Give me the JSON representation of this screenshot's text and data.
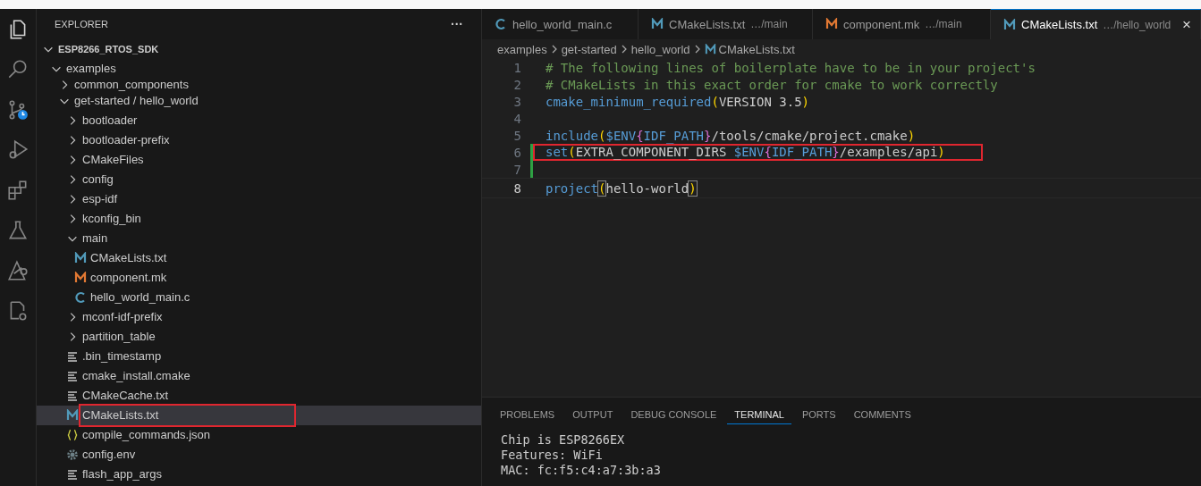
{
  "activity_bar": [
    {
      "kind": "files",
      "selected": true
    },
    {
      "kind": "search",
      "selected": false
    },
    {
      "kind": "source_control",
      "selected": false
    },
    {
      "kind": "run_debug",
      "selected": false
    },
    {
      "kind": "extensions",
      "selected": false
    },
    {
      "kind": "testing",
      "selected": false
    },
    {
      "kind": "idf",
      "selected": false
    },
    {
      "kind": "cpp_config",
      "selected": false
    }
  ],
  "sidebar": {
    "title": "EXPLORER",
    "more": "···",
    "tree": [
      {
        "label": "ESP8266_RTOS_SDK",
        "kind": "folder",
        "expanded": true,
        "selected": false,
        "children": [
          {
            "label": "examples",
            "kind": "folder",
            "expanded": true,
            "selected": false,
            "children": [
              {
                "label": "common_components",
                "kind": "folder",
                "expanded": false,
                "selected": false,
                "sticky_under": true
              },
              {
                "label": "get-started / hello_world",
                "kind": "folder",
                "expanded": true,
                "selected": false,
                "children": [
                  {
                    "label": "bootloader",
                    "kind": "folder",
                    "expanded": false,
                    "selected": false
                  },
                  {
                    "label": "bootloader-prefix",
                    "kind": "folder",
                    "expanded": false,
                    "selected": false
                  },
                  {
                    "label": "CMakeFiles",
                    "kind": "folder",
                    "expanded": false,
                    "selected": false
                  },
                  {
                    "label": "config",
                    "kind": "folder",
                    "expanded": false,
                    "selected": false
                  },
                  {
                    "label": "esp-idf",
                    "kind": "folder",
                    "expanded": false,
                    "selected": false
                  },
                  {
                    "label": "kconfig_bin",
                    "kind": "folder",
                    "expanded": false,
                    "selected": false
                  },
                  {
                    "label": "main",
                    "kind": "folder",
                    "expanded": true,
                    "selected": false,
                    "children": [
                      {
                        "label": "CMakeLists.txt",
                        "kind": "cmake",
                        "selected": false
                      },
                      {
                        "label": "component.mk",
                        "kind": "make",
                        "selected": false
                      },
                      {
                        "label": "hello_world_main.c",
                        "kind": "c",
                        "selected": false
                      }
                    ]
                  },
                  {
                    "label": "mconf-idf-prefix",
                    "kind": "folder",
                    "expanded": false,
                    "selected": false
                  },
                  {
                    "label": "partition_table",
                    "kind": "folder",
                    "expanded": false,
                    "selected": false
                  },
                  {
                    "label": ".bin_timestamp",
                    "kind": "text",
                    "selected": false
                  },
                  {
                    "label": "cmake_install.cmake",
                    "kind": "text",
                    "selected": false
                  },
                  {
                    "label": "CMakeCache.txt",
                    "kind": "text",
                    "selected": false
                  },
                  {
                    "label": "CMakeLists.txt",
                    "kind": "cmake",
                    "selected": true,
                    "annotated": true
                  },
                  {
                    "label": "compile_commands.json",
                    "kind": "json",
                    "selected": false
                  },
                  {
                    "label": "config.env",
                    "kind": "config",
                    "selected": false
                  },
                  {
                    "label": "flash_app_args",
                    "kind": "text",
                    "selected": false
                  }
                ]
              }
            ]
          }
        ]
      }
    ]
  },
  "editor": {
    "tabs": [
      {
        "label": "hello_world_main.c",
        "kind": "c",
        "selected": false
      },
      {
        "label": "CMakeLists.txt",
        "path": "…/main",
        "kind": "cmake",
        "selected": false
      },
      {
        "label": "component.mk",
        "path": "…/main",
        "kind": "make",
        "selected": false
      },
      {
        "label": "CMakeLists.txt",
        "path": "…/hello_world",
        "kind": "cmake",
        "selected": true,
        "close": "×"
      }
    ],
    "breadcrumbs": [
      {
        "label": "examples"
      },
      {
        "label": "get-started"
      },
      {
        "label": "hello_world"
      },
      {
        "label": "CMakeLists.txt",
        "kind": "cmake"
      }
    ],
    "lines": [
      {
        "number": "1",
        "current": false,
        "modified": false,
        "tokens": [
          {
            "text": "# The following lines of boilerplate have to be in your project's",
            "kind": "comment"
          }
        ]
      },
      {
        "number": "2",
        "current": false,
        "modified": false,
        "tokens": [
          {
            "text": "# CMakeLists in this exact order for cmake to work correctly",
            "kind": "comment"
          }
        ]
      },
      {
        "number": "3",
        "current": false,
        "modified": false,
        "tokens": [
          {
            "text": "cmake_minimum_required",
            "kind": "func"
          },
          {
            "text": "(",
            "kind": "paren"
          },
          {
            "text": "VERSION 3.5",
            "kind": "plain"
          },
          {
            "text": ")",
            "kind": "paren"
          }
        ]
      },
      {
        "number": "4",
        "current": false,
        "modified": false
      },
      {
        "number": "5",
        "current": false,
        "modified": false,
        "tokens": [
          {
            "text": "include",
            "kind": "func"
          },
          {
            "text": "(",
            "kind": "paren"
          },
          {
            "text": "$ENV",
            "kind": "var"
          },
          {
            "text": "{",
            "kind": "brace"
          },
          {
            "text": "IDF_PATH",
            "kind": "var"
          },
          {
            "text": "}",
            "kind": "brace"
          },
          {
            "text": "/tools/cmake/project.cmake",
            "kind": "plain"
          },
          {
            "text": ")",
            "kind": "paren"
          }
        ]
      },
      {
        "number": "6",
        "current": false,
        "modified": true,
        "annotated": true,
        "tokens": [
          {
            "text": "set",
            "kind": "func"
          },
          {
            "text": "(",
            "kind": "paren"
          },
          {
            "text": "EXTRA_COMPONENT_DIRS ",
            "kind": "plain"
          },
          {
            "text": "$ENV",
            "kind": "var"
          },
          {
            "text": "{",
            "kind": "brace"
          },
          {
            "text": "IDF_PATH",
            "kind": "var"
          },
          {
            "text": "}",
            "kind": "brace"
          },
          {
            "text": "/examples/api",
            "kind": "plain"
          },
          {
            "text": ")",
            "kind": "paren"
          }
        ]
      },
      {
        "number": "7",
        "current": false,
        "modified": true
      },
      {
        "number": "8",
        "current": true,
        "modified": false,
        "tokens": [
          {
            "text": "project",
            "kind": "func"
          },
          {
            "text": "(",
            "kind": "match"
          },
          {
            "text": "hello-world",
            "kind": "plain"
          },
          {
            "text": ")",
            "kind": "match"
          }
        ]
      }
    ]
  },
  "panel": {
    "tabs": [
      {
        "label": "PROBLEMS",
        "selected": false
      },
      {
        "label": "OUTPUT",
        "selected": false
      },
      {
        "label": "DEBUG CONSOLE",
        "selected": false
      },
      {
        "label": "TERMINAL",
        "selected": true
      },
      {
        "label": "PORTS",
        "selected": false
      },
      {
        "label": "COMMENTS",
        "selected": false
      }
    ],
    "terminal_lines": [
      "Chip is ESP8266EX",
      "Features: WiFi",
      "MAC: fc:f5:c4:a7:3b:a3"
    ]
  }
}
